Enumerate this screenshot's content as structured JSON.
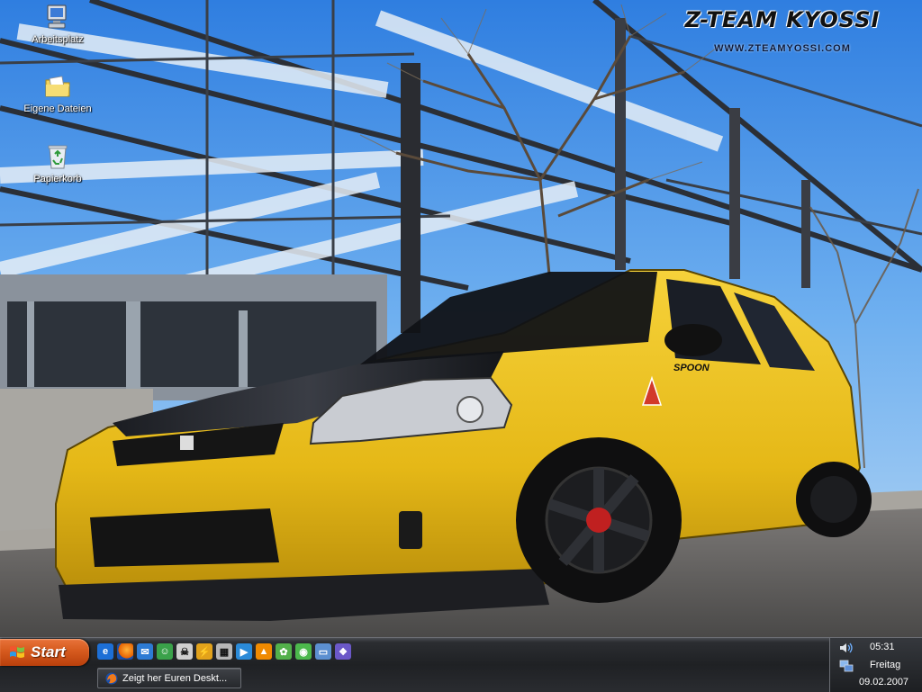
{
  "wallpaper": {
    "brand_logo": "Z-TEAM KYOSSI",
    "brand_url": "WWW.ZTEAMYOSSI.COM",
    "car_badge": "SPOON"
  },
  "desktop": {
    "icons": [
      {
        "label": "Arbeitsplatz",
        "icon": "my-computer-icon"
      },
      {
        "label": "Eigene Dateien",
        "icon": "my-documents-folder-icon"
      },
      {
        "label": "Papierkorb",
        "icon": "recycle-bin-icon"
      }
    ]
  },
  "taskbar": {
    "start_label": "Start",
    "quick_launch": [
      {
        "icon": "internet-explorer-icon",
        "color": "#1d6fd6"
      },
      {
        "icon": "firefox-icon",
        "color": "#e66000"
      },
      {
        "icon": "outlook-express-icon",
        "color": "#2d7bd4"
      },
      {
        "icon": "messenger-icon",
        "color": "#3aa24a"
      },
      {
        "icon": "skull-app-icon",
        "color": "#cfcfcf"
      },
      {
        "icon": "winamp-icon",
        "color": "#e2a21b"
      },
      {
        "icon": "calculator-icon",
        "color": "#b7b7b7"
      },
      {
        "icon": "media-player-icon",
        "color": "#2a8ad8"
      },
      {
        "icon": "vlc-icon",
        "color": "#f08a00"
      },
      {
        "icon": "icq-icon",
        "color": "#53b04b"
      },
      {
        "icon": "green-app-icon",
        "color": "#4cb84c"
      },
      {
        "icon": "show-desktop-icon",
        "color": "#5c8fd0"
      },
      {
        "icon": "switch-windows-icon",
        "color": "#6b58c8"
      }
    ],
    "window_button": {
      "label": "Zeigt her Euren Deskt...",
      "icon": "firefox-icon"
    }
  },
  "tray": {
    "time": "05:31",
    "day": "Freitag",
    "date": "09.02.2007",
    "icons": [
      "volume-icon",
      "network-icon"
    ]
  }
}
